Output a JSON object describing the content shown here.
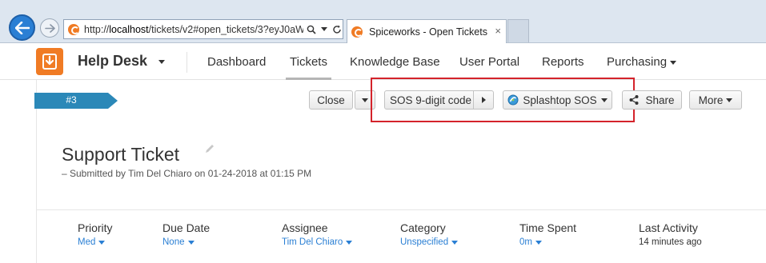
{
  "browser": {
    "url_prefix": "http://",
    "url_host": "localhost",
    "url_path": "/tickets/v2#open_tickets/3?eyJ0aWI",
    "tab_title": "Spiceworks - Open Tickets",
    "tab_close": "×"
  },
  "nav": {
    "brand": "Help Desk",
    "items": [
      "Dashboard",
      "Tickets",
      "Knowledge Base",
      "User Portal",
      "Reports",
      "Purchasing"
    ],
    "active": "Tickets"
  },
  "ticket": {
    "tag": "#3",
    "title": "Support Ticket",
    "submitted": "– Submitted by Tim Del Chiaro on 01-24-2018 at 01:15 PM"
  },
  "toolbar": {
    "close": "Close",
    "sos_code": "SOS 9-digit code",
    "splashtop": "Splashtop SOS",
    "share": "Share",
    "more": "More"
  },
  "properties": [
    {
      "label": "Priority",
      "value": "Med",
      "dropdown": true
    },
    {
      "label": "Due Date",
      "value": "None",
      "dropdown": true
    },
    {
      "label": "Assignee",
      "value": "Tim Del Chiaro",
      "dropdown": true
    },
    {
      "label": "Category",
      "value": "Unspecified",
      "dropdown": true
    },
    {
      "label": "Time Spent",
      "value": "0m",
      "dropdown": true
    },
    {
      "label": "Last Activity",
      "value": "14 minutes ago",
      "dropdown": false
    }
  ],
  "colors": {
    "accent": "#2a7fd4",
    "brand": "#f07b24",
    "highlight": "#d4232b",
    "tag": "#2b88b8"
  }
}
